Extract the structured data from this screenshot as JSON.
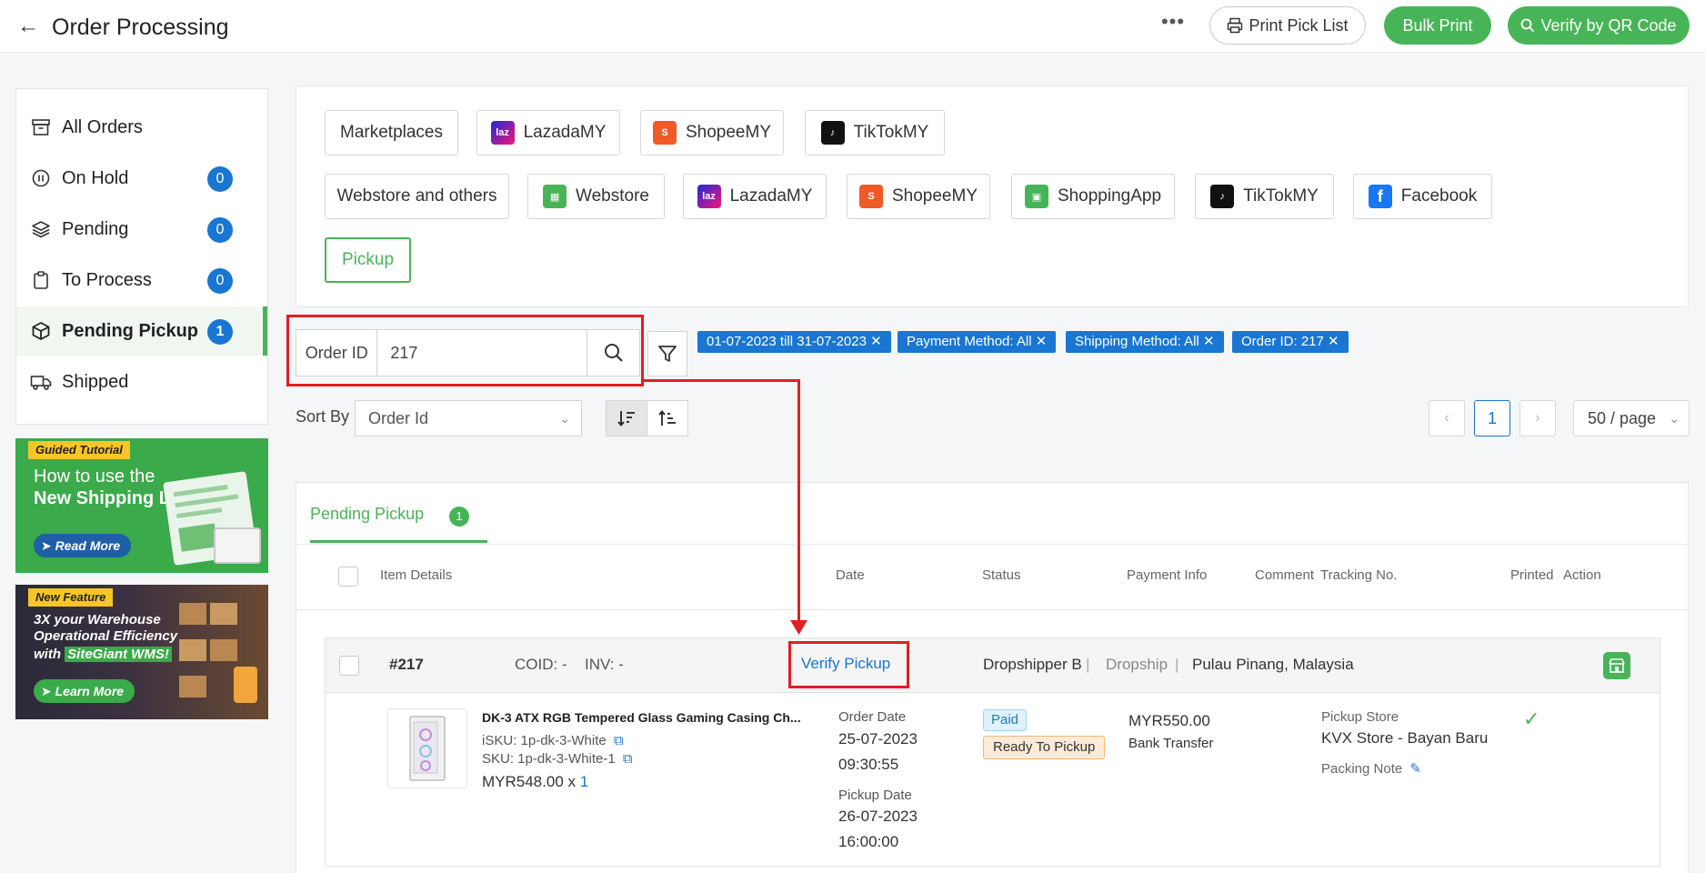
{
  "header": {
    "title": "Order Processing",
    "print_pick_list": "Print Pick List",
    "bulk_print": "Bulk Print",
    "verify_qr": "Verify by QR Code"
  },
  "sidebar": {
    "items": [
      {
        "label": "All Orders",
        "icon": "archive-icon",
        "count": null
      },
      {
        "label": "On Hold",
        "icon": "pause-icon",
        "count": "0"
      },
      {
        "label": "Pending",
        "icon": "layers-icon",
        "count": "0"
      },
      {
        "label": "To Process",
        "icon": "clipboard-icon",
        "count": "0"
      },
      {
        "label": "Pending Pickup",
        "icon": "box-icon",
        "count": "1",
        "active": true
      },
      {
        "label": "Shipped",
        "icon": "truck-icon",
        "count": null
      }
    ]
  },
  "banners": {
    "tutorial": {
      "tag": "Guided Tutorial",
      "line1": "How to use the",
      "line2": "New Shipping Label?",
      "button": "Read More"
    },
    "feature": {
      "tag": "New Feature",
      "line1": "3X your Warehouse",
      "line2": "Operational Efficiency",
      "line3_pre": "with",
      "line3_brand": "SiteGiant WMS!",
      "button": "Learn More"
    }
  },
  "channels": {
    "row1": [
      "Marketplaces",
      "LazadaMY",
      "ShopeeMY",
      "TikTokMY"
    ],
    "row2": [
      "Webstore and others",
      "Webstore",
      "LazadaMY",
      "ShopeeMY",
      "ShoppingApp",
      "TikTokMY",
      "Facebook"
    ],
    "row3": [
      "Pickup"
    ]
  },
  "search": {
    "field_label": "Order ID",
    "value": "217"
  },
  "filters": [
    "01-07-2023 till 31-07-2023",
    "Payment Method: All",
    "Shipping Method: All",
    "Order ID: 217"
  ],
  "sort": {
    "label": "Sort By",
    "selected": "Order Id"
  },
  "pagination": {
    "current": "1",
    "per_page": "50 / page"
  },
  "tabs": [
    {
      "label": "Pending Pickup",
      "count": "1"
    }
  ],
  "table": {
    "headers": [
      "Item Details",
      "Date",
      "Status",
      "Payment Info",
      "Comment",
      "Tracking No.",
      "Printed",
      "Action"
    ]
  },
  "order": {
    "id": "#217",
    "coid": "COID: -",
    "inv": "INV: -",
    "verify": "Verify Pickup",
    "customer": "Dropshipper B",
    "type": "Dropship",
    "location": "Pulau Pinang, Malaysia",
    "product_name": "DK-3 ATX RGB Tempered Glass Gaming Casing Ch...",
    "isku": "iSKU: 1p-dk-3-White",
    "sku": "SKU: 1p-dk-3-White-1",
    "price": "MYR548.00 x ",
    "qty": "1",
    "order_date_label": "Order Date",
    "order_date": "25-07-2023",
    "order_time": "09:30:55",
    "pickup_date_label": "Pickup Date",
    "pickup_date": "26-07-2023",
    "pickup_time": "16:00:00",
    "status_paid": "Paid",
    "status_ready": "Ready To Pickup",
    "amount": "MYR550.00",
    "payment_method": "Bank Transfer",
    "pickup_store_label": "Pickup Store",
    "pickup_store": "KVX Store - Bayan Baru",
    "packing_note": "Packing Note"
  },
  "colors": {
    "accent_green": "#47b557",
    "accent_blue": "#1976d2",
    "highlight_red": "#e31e24"
  }
}
